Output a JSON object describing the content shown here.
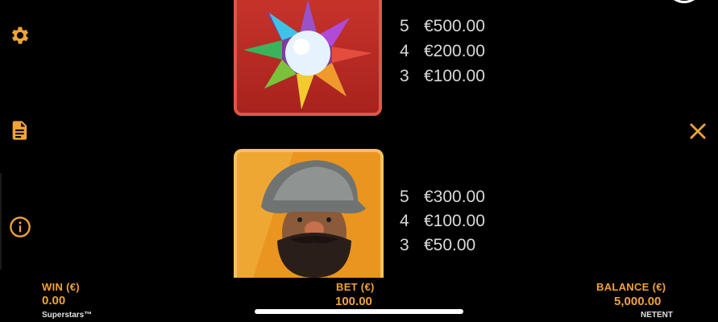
{
  "sidebar": {
    "icons": [
      {
        "name": "settings-icon"
      },
      {
        "name": "paytable-icon"
      },
      {
        "name": "info-icon"
      }
    ]
  },
  "paytable": {
    "symbols": [
      {
        "name": "star-gems-symbol",
        "payouts": [
          {
            "count": "5",
            "amount": "€500.00"
          },
          {
            "count": "4",
            "amount": "€200.00"
          },
          {
            "count": "3",
            "amount": "€100.00"
          }
        ]
      },
      {
        "name": "conquistador-symbol",
        "payouts": [
          {
            "count": "5",
            "amount": "€300.00"
          },
          {
            "count": "4",
            "amount": "€100.00"
          },
          {
            "count": "3",
            "amount": "€50.00"
          }
        ]
      }
    ]
  },
  "footer": {
    "win_label": "WIN (€)",
    "win_value": "0.00",
    "game_name": "Superstars™",
    "bet_label": "BET (€)",
    "bet_value": "100.00",
    "balance_label": "BALANCE (€)",
    "balance_value": "5,000.00",
    "brand": "NETENT"
  },
  "colors": {
    "accent": "#f0a23a",
    "background": "#000000",
    "text": "#d9d9d9"
  }
}
